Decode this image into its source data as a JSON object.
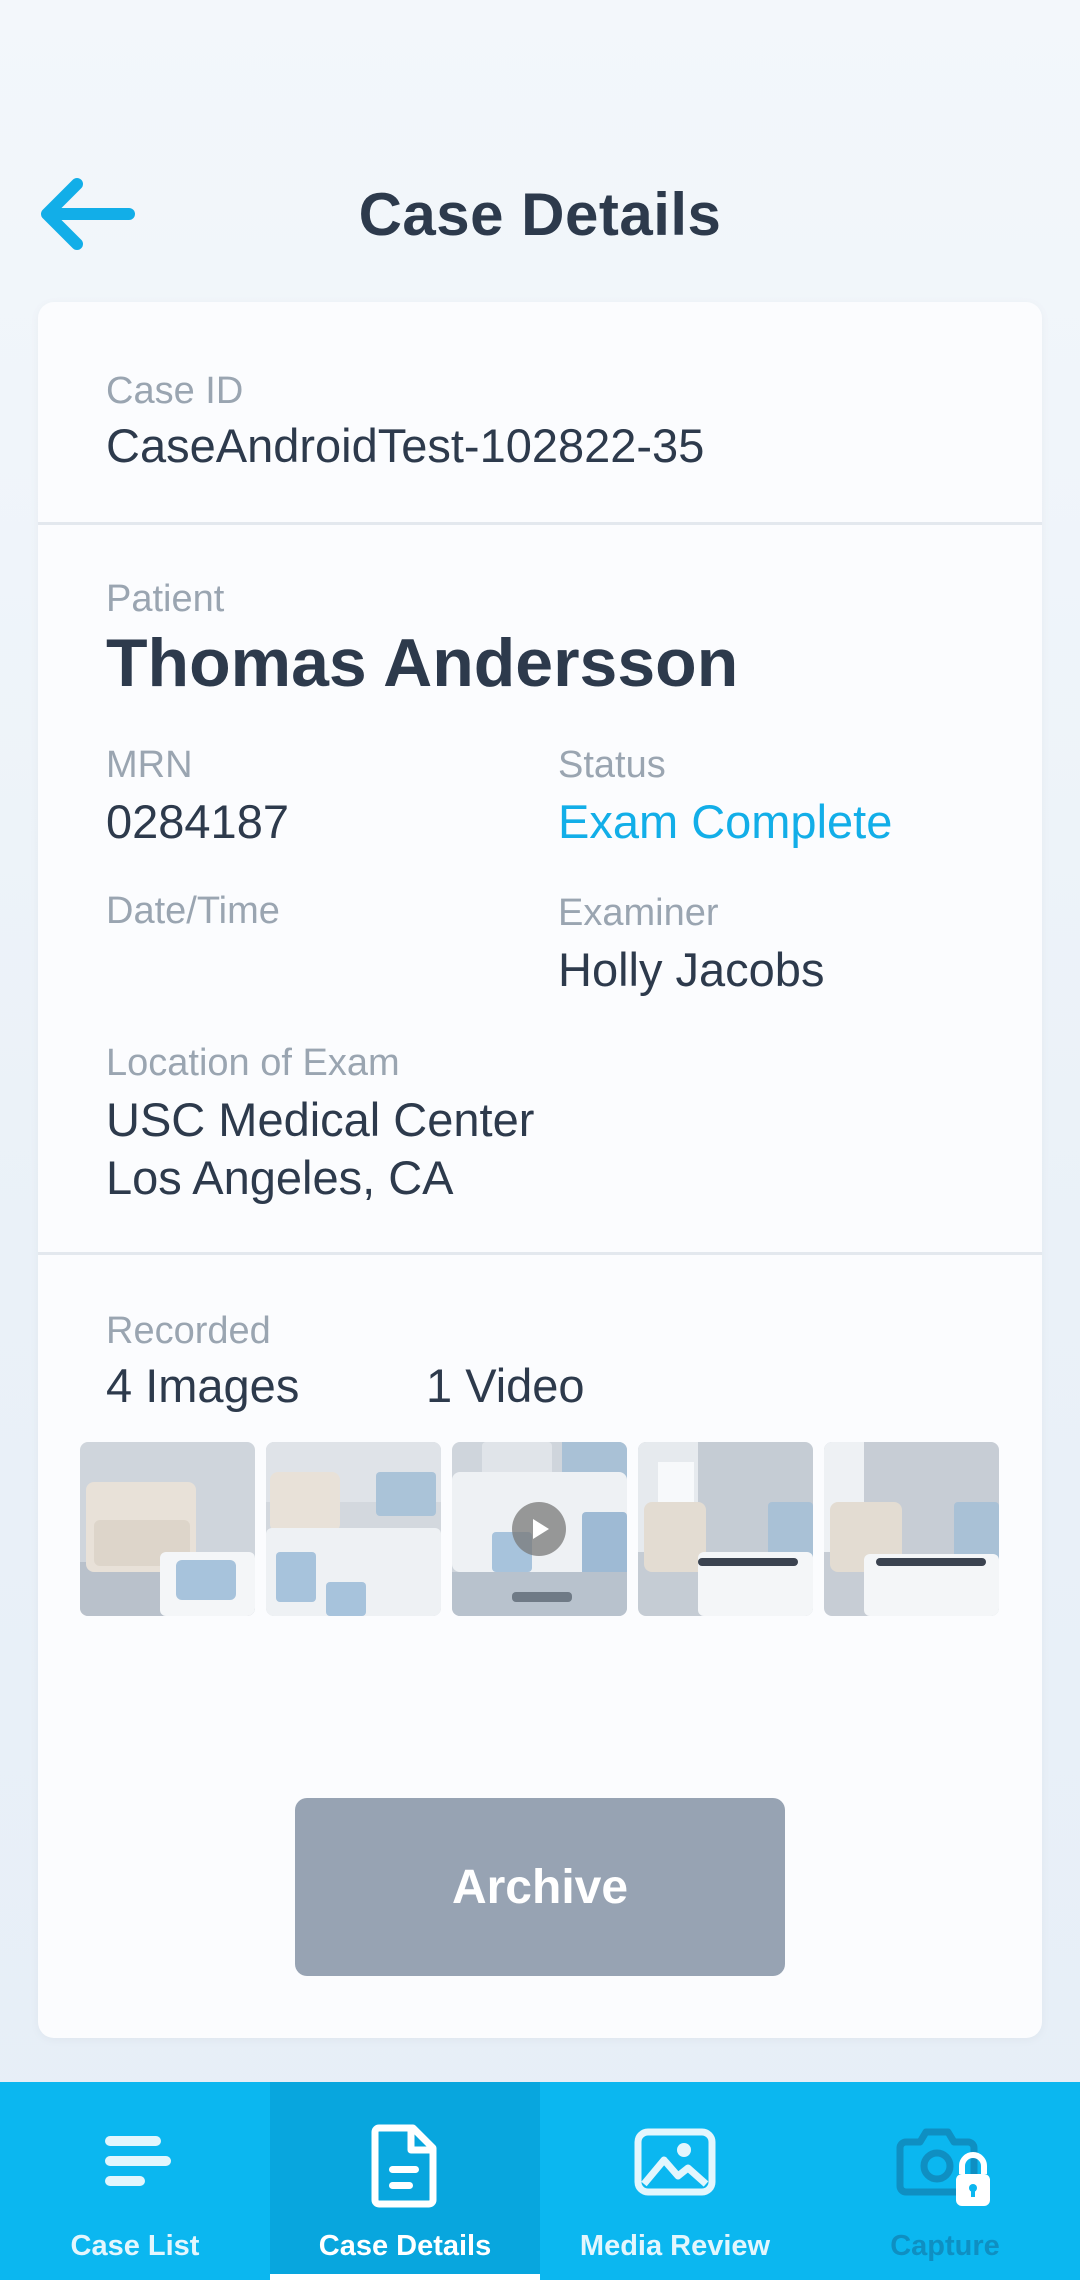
{
  "header": {
    "title": "Case Details"
  },
  "case": {
    "id_label": "Case ID",
    "id_value": "CaseAndroidTest-102822-35"
  },
  "patient": {
    "label": "Patient",
    "name": "Thomas Andersson",
    "mrn_label": "MRN",
    "mrn_value": "0284187",
    "status_label": "Status",
    "status_value": "Exam Complete",
    "datetime_label": "Date/Time",
    "datetime_value": "",
    "examiner_label": "Examiner",
    "examiner_value": "Holly Jacobs",
    "location_label": "Location of Exam",
    "location_line1": "USC Medical Center",
    "location_line2": "Los Angeles, CA"
  },
  "recorded": {
    "label": "Recorded",
    "images_count": "4 Images",
    "video_count": "1 Video",
    "thumbnails": [
      {
        "kind": "image",
        "icon": "none"
      },
      {
        "kind": "image",
        "icon": "none"
      },
      {
        "kind": "video",
        "icon": "play-icon"
      },
      {
        "kind": "image",
        "icon": "none"
      },
      {
        "kind": "image",
        "icon": "none"
      }
    ]
  },
  "actions": {
    "archive_label": "Archive"
  },
  "tabs": [
    {
      "label": "Case List",
      "icon": "list-icon",
      "active": false
    },
    {
      "label": "Case Details",
      "icon": "document-icon",
      "active": true
    },
    {
      "label": "Media Review",
      "icon": "image-icon",
      "active": false
    },
    {
      "label": "Capture",
      "icon": "camera-lock-icon",
      "active": false
    }
  ],
  "colors": {
    "accent": "#12aee8",
    "tabbar": "#0bb7f0",
    "text": "#2d3a4c",
    "muted": "#9aa5b1",
    "archive": "#97a3b3"
  }
}
